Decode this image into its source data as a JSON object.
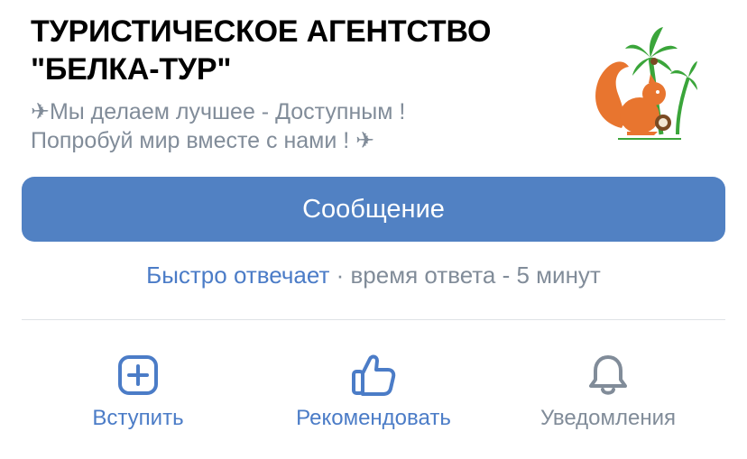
{
  "group": {
    "title_line1": "ТУРИСТИЧЕСКОЕ АГЕНТСТВО",
    "title_line2": "\"БЕЛКА-ТУР\"",
    "description_line1": "✈Мы делаем лучшее - Доступным !",
    "description_line2": "Попробуй мир вместе с нами ! ✈",
    "logo_icon": "squirrel-palm-logo"
  },
  "message_button": {
    "label": "Сообщение"
  },
  "response": {
    "fast_label": "Быстро отвечает",
    "separator": " · ",
    "time_text": "время ответа - 5 минут"
  },
  "actions": {
    "join": {
      "label": "Вступить",
      "icon": "plus-square-icon",
      "color": "#4b7cc7"
    },
    "recommend": {
      "label": "Рекомендовать",
      "icon": "thumbs-up-icon",
      "color": "#4b7cc7"
    },
    "notifications": {
      "label": "Уведомления",
      "icon": "bell-icon",
      "color": "#818c99"
    }
  },
  "colors": {
    "accent": "#5181c3",
    "link": "#4b7cc7",
    "secondary_text": "#818c99",
    "logo_orange": "#e8752f",
    "logo_green": "#3aa53a"
  }
}
